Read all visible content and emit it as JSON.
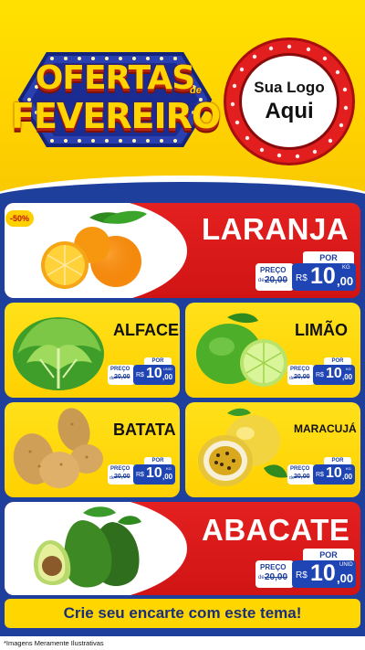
{
  "header": {
    "promo_line1": "OFERTAS",
    "promo_de": "de",
    "promo_line2": "FEVEREIRO",
    "logo_line1": "Sua Logo",
    "logo_line2": "Aqui"
  },
  "colors": {
    "brand_yellow": "#ffd600",
    "brand_red": "#e42020",
    "brand_blue": "#1e3f9c"
  },
  "products": {
    "laranja": {
      "name": "LARANJA",
      "badge": "-50%",
      "por": "POR",
      "preco_label": "PREÇO",
      "de": "de",
      "old_price": "20,00",
      "currency": "R$",
      "price_int": "10",
      "price_dec": ",00",
      "unit": "KG"
    },
    "alface": {
      "name": "ALFACE",
      "por": "POR",
      "preco_label": "PREÇO",
      "de": "de",
      "old_price": "20,00",
      "currency": "R$",
      "price_int": "10",
      "price_dec": ",00",
      "unit": "UNID"
    },
    "limao": {
      "name": "LIMÃO",
      "por": "POR",
      "preco_label": "PREÇO",
      "de": "de",
      "old_price": "20,00",
      "currency": "R$",
      "price_int": "10",
      "price_dec": ",00",
      "unit": "KG"
    },
    "batata": {
      "name": "BATATA",
      "por": "POR",
      "preco_label": "PREÇO",
      "de": "de",
      "old_price": "20,00",
      "currency": "R$",
      "price_int": "10",
      "price_dec": ",00",
      "unit": "KG"
    },
    "maracuja": {
      "name": "MARACUJÁ",
      "por": "POR",
      "preco_label": "PREÇO",
      "de": "de",
      "old_price": "20,00",
      "currency": "R$",
      "price_int": "10",
      "price_dec": ",00",
      "unit": "KG"
    },
    "abacate": {
      "name": "ABACATE",
      "por": "POR",
      "preco_label": "PREÇO",
      "de": "de",
      "old_price": "20,00",
      "currency": "R$",
      "price_int": "10",
      "price_dec": ",00",
      "unit": "UNID"
    }
  },
  "footer": {
    "cta": "Crie seu encarte com este tema!",
    "disclaimer": "*Imagens Meramente Ilustrativas"
  }
}
